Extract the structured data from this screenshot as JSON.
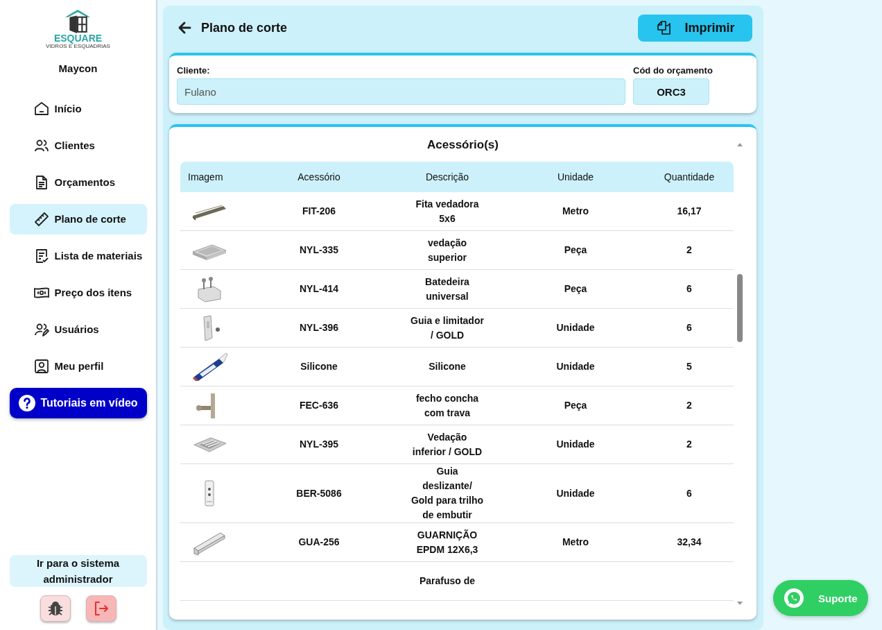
{
  "logo": {
    "name": "ESQUARE",
    "tagline": "VIDROS E ESQUADRIAS"
  },
  "user": {
    "name": "Maycon"
  },
  "sidebar": {
    "items": [
      {
        "label": "Início",
        "selected": false
      },
      {
        "label": "Clientes",
        "selected": false
      },
      {
        "label": "Orçamentos",
        "selected": false
      },
      {
        "label": "Plano de corte",
        "selected": true
      },
      {
        "label": "Lista de materiais",
        "selected": false
      },
      {
        "label": "Preço dos itens",
        "selected": false
      },
      {
        "label": "Usuários",
        "selected": false
      },
      {
        "label": "Meu perfil",
        "selected": false
      }
    ],
    "tutorial_button": "Tutoriais em vídeo",
    "admin_link": "Ir para o sistema administrador"
  },
  "header": {
    "title": "Plano de corte",
    "print_button": "Imprimir"
  },
  "form": {
    "client_label": "Cliente:",
    "client_value": "Fulano",
    "code_label": "Cód do orçamento",
    "code_value": "ORC3"
  },
  "table": {
    "title": "Acessório(s)",
    "columns": [
      "Imagem",
      "Acessório",
      "Descrição",
      "Unidade",
      "Quantidade"
    ],
    "rows": [
      {
        "code": "FIT-206",
        "description": "Fita vedadora 5x6",
        "unit": "Metro",
        "quantity": "16,17"
      },
      {
        "code": "NYL-335",
        "description": "vedação superior",
        "unit": "Peça",
        "quantity": "2"
      },
      {
        "code": "NYL-414",
        "description": "Batedeira universal",
        "unit": "Peça",
        "quantity": "6"
      },
      {
        "code": "NYL-396",
        "description": "Guia e limitador  / GOLD",
        "unit": "Unidade",
        "quantity": "6"
      },
      {
        "code": "Silicone",
        "description": "Silicone",
        "unit": "Unidade",
        "quantity": "5"
      },
      {
        "code": "FEC-636",
        "description": "fecho concha com trava",
        "unit": "Peça",
        "quantity": "2"
      },
      {
        "code": "NYL-395",
        "description": "Vedação inferior / GOLD",
        "unit": "Unidade",
        "quantity": "2"
      },
      {
        "code": "BER-5086",
        "description": "Guia deslizante/ Gold para trilho de embutir",
        "unit": "Unidade",
        "quantity": "6"
      },
      {
        "code": "GUA-256",
        "description": "GUARNIÇÃO EPDM 12X6,3",
        "unit": "Metro",
        "quantity": "32,34"
      },
      {
        "description": "Parafuso de"
      }
    ]
  },
  "support_button": "Suporte"
}
